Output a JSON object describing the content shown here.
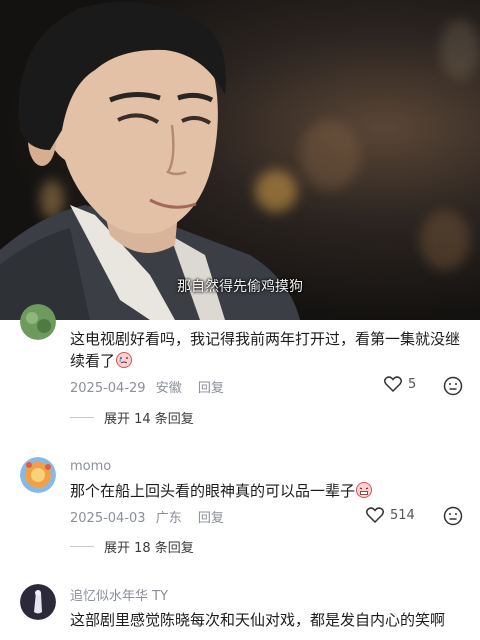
{
  "video": {
    "subtitle": "那自然得先偷鸡摸狗"
  },
  "comments": [
    {
      "text": "这电视剧好看吗，我记得我前两年打开过，看第一集就没继续看了",
      "date": "2025-04-29",
      "location": "安徽",
      "reply_label": "回复",
      "likes": "5",
      "expand_label": "展开 14 条回复",
      "emoji_icon": "crying-face-icon"
    },
    {
      "username": "momo",
      "text": "那个在船上回头看的眼神真的可以品一辈子",
      "date": "2025-04-03",
      "location": "广东",
      "reply_label": "回复",
      "likes": "514",
      "expand_label": "展开 18 条回复",
      "emoji_icon": "grimace-face-icon"
    },
    {
      "username": "追忆似水年华 TY",
      "text": "这部剧里感觉陈晓每次和天仙对戏，都是发自内心的笑啊"
    }
  ],
  "colors": {
    "meta_gray": "#8a8f99",
    "text_dark": "#1c1c1e"
  }
}
